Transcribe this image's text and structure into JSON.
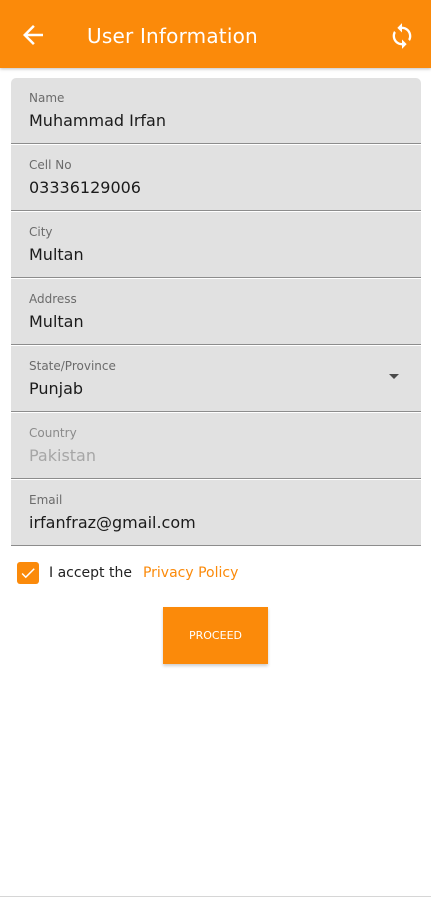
{
  "app_bar": {
    "title": "User Information",
    "back_icon": "arrow-left-icon",
    "refresh_icon": "refresh-icon",
    "color": "#fb8a0a"
  },
  "form": {
    "fields": [
      {
        "label": "Name",
        "value": "Muhammad Irfan"
      },
      {
        "label": "Cell No",
        "value": "03336129006"
      },
      {
        "label": "City",
        "value": "Multan"
      },
      {
        "label": "Address",
        "value": "Multan"
      },
      {
        "label": "State/Province",
        "value": "Punjab",
        "type": "dropdown"
      },
      {
        "label": "Country",
        "value": "Pakistan",
        "disabled": true
      },
      {
        "label": "Email",
        "value": "irfanfraz@gmail.com"
      }
    ]
  },
  "consent": {
    "checked": true,
    "text": "I accept the",
    "link_text": "Privacy Policy"
  },
  "proceed": {
    "label": "PROCEED"
  }
}
